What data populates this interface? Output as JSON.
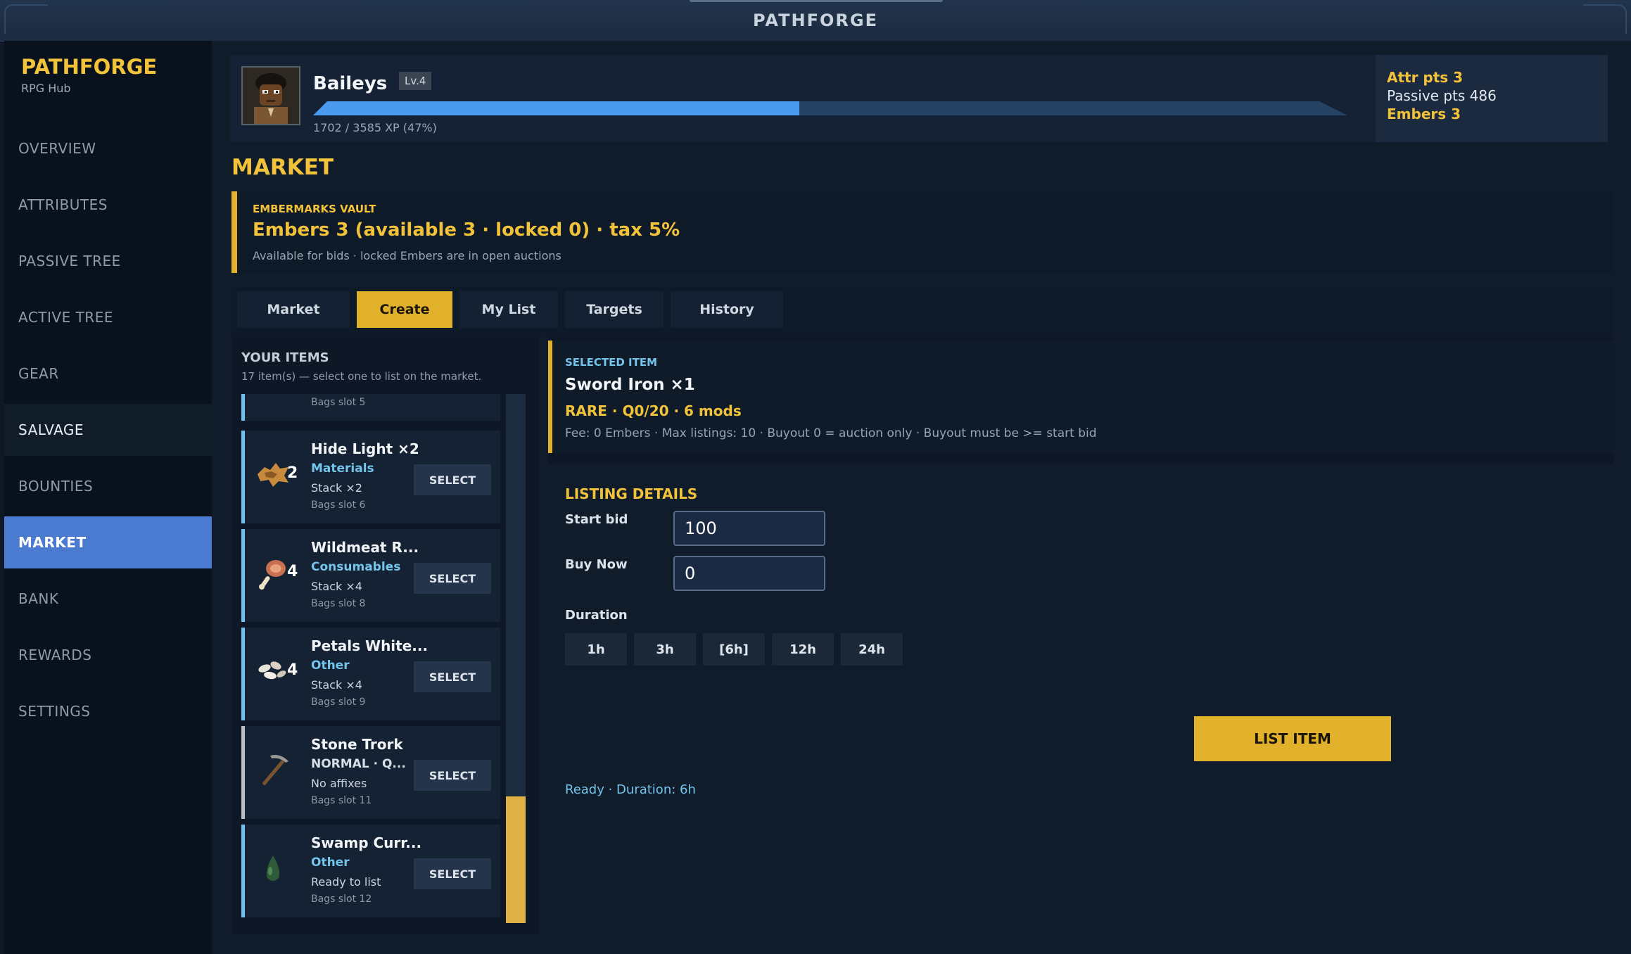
{
  "window": {
    "title": "PATHFORGE"
  },
  "brand": {
    "title": "PATHFORGE",
    "subtitle": "RPG Hub"
  },
  "nav": [
    {
      "label": "OVERVIEW",
      "state": "normal"
    },
    {
      "label": "ATTRIBUTES",
      "state": "normal"
    },
    {
      "label": "PASSIVE TREE",
      "state": "normal"
    },
    {
      "label": "ACTIVE TREE",
      "state": "normal"
    },
    {
      "label": "GEAR",
      "state": "normal"
    },
    {
      "label": "SALVAGE",
      "state": "dim"
    },
    {
      "label": "BOUNTIES",
      "state": "normal"
    },
    {
      "label": "MARKET",
      "state": "active"
    },
    {
      "label": "BANK",
      "state": "normal"
    },
    {
      "label": "REWARDS",
      "state": "normal"
    },
    {
      "label": "SETTINGS",
      "state": "normal"
    }
  ],
  "player": {
    "name": "Baileys",
    "level": "Lv.4",
    "xp_text": "1702 / 3585 XP (47%)",
    "xp_fraction": 0.47
  },
  "stats": {
    "attr": "Attr pts  3",
    "passive": "Passive pts  486",
    "embers": "Embers  3"
  },
  "page": {
    "title": "MARKET"
  },
  "vault": {
    "label": "EMBERMARKS VAULT",
    "main": "Embers  3  (available 3 · locked 0)  ·  tax 5%",
    "note": "Available for bids · locked Embers are in open auctions"
  },
  "tabs": [
    "Market",
    "Create",
    "My List",
    "Targets",
    "History"
  ],
  "items_panel": {
    "title": "YOUR ITEMS",
    "subtitle": "17 item(s) — select one to list on the market.",
    "select_label": "SELECT",
    "partial_slot": "Bags slot 5",
    "items": [
      {
        "name": "Hide Light  ×2",
        "category": "Materials",
        "line3": "Stack ×2",
        "slot": "Bags slot 6",
        "count": "2",
        "icon": "hide-icon"
      },
      {
        "name": "Wildmeat R...",
        "category": "Consumables",
        "line3": "Stack ×4",
        "slot": "Bags slot 8",
        "count": "4",
        "icon": "meat-icon"
      },
      {
        "name": "Petals White...",
        "category": "Other",
        "line3": "Stack ×4",
        "slot": "Bags slot 9",
        "count": "4",
        "icon": "petals-icon"
      },
      {
        "name": "Stone Trork",
        "category": "NORMAL  ·  Q...",
        "line3": "No affixes",
        "slot": "Bags slot 11",
        "count": "",
        "icon": "pickaxe-icon"
      },
      {
        "name": "Swamp Curr...",
        "category": "Other",
        "line3": "Ready to list",
        "slot": "Bags slot 12",
        "count": "",
        "icon": "currant-icon"
      }
    ]
  },
  "selected": {
    "label": "SELECTED ITEM",
    "name": "Sword Iron  ×1",
    "meta": "RARE  ·  Q0/20  ·  6 mods",
    "fee": "Fee: 0 Embers · Max listings: 10 · Buyout 0 = auction only · Buyout must be >= start bid"
  },
  "listing": {
    "title": "LISTING DETAILS",
    "start_bid_label": "Start bid",
    "start_bid_value": "100",
    "buy_now_label": "Buy Now",
    "buy_now_value": "0",
    "duration_label": "Duration",
    "durations": [
      "1h",
      "3h",
      "[6h]",
      "12h",
      "24h"
    ],
    "list_button": "LIST ITEM",
    "status": "Ready · Duration: 6h"
  },
  "colors": {
    "accent_gold": "#e2b12c",
    "accent_blue": "#4a7bd0",
    "xp_fill": "#4a9bf0",
    "category_blue": "#74c4ec"
  }
}
